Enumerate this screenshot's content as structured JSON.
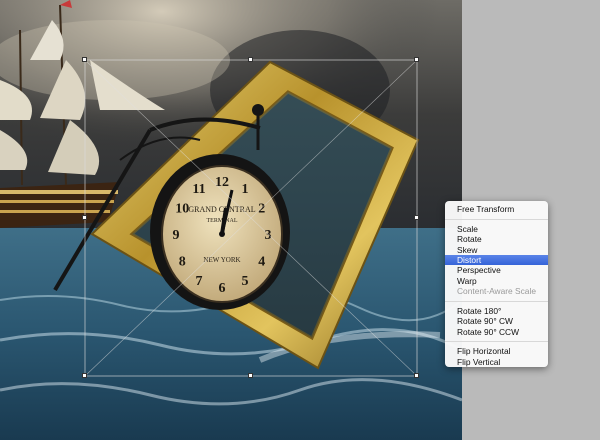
{
  "clock": {
    "line1": "GRAND CENTRAL",
    "line2": "TERMINAL",
    "city": "NEW YORK",
    "numerals": [
      "12",
      "1",
      "2",
      "3",
      "4",
      "5",
      "6",
      "7",
      "8",
      "9",
      "10",
      "11"
    ]
  },
  "context_menu": {
    "groups": [
      [
        {
          "label": "Free Transform",
          "state": "normal"
        }
      ],
      [
        {
          "label": "Scale",
          "state": "normal"
        },
        {
          "label": "Rotate",
          "state": "normal"
        },
        {
          "label": "Skew",
          "state": "normal"
        },
        {
          "label": "Distort",
          "state": "selected"
        },
        {
          "label": "Perspective",
          "state": "normal"
        },
        {
          "label": "Warp",
          "state": "normal"
        },
        {
          "label": "Content-Aware Scale",
          "state": "disabled"
        }
      ],
      [
        {
          "label": "Rotate 180°",
          "state": "normal"
        },
        {
          "label": "Rotate 90° CW",
          "state": "normal"
        },
        {
          "label": "Rotate 90° CCW",
          "state": "normal"
        }
      ],
      [
        {
          "label": "Flip Horizontal",
          "state": "normal"
        },
        {
          "label": "Flip Vertical",
          "state": "normal"
        }
      ]
    ]
  },
  "colors": {
    "menu_highlight": "#3a68dc",
    "pasteboard": "#bababa",
    "sea": "#2e5d78",
    "frame_gold": "#c9a93a",
    "clock_face": "#e8d7ae"
  }
}
